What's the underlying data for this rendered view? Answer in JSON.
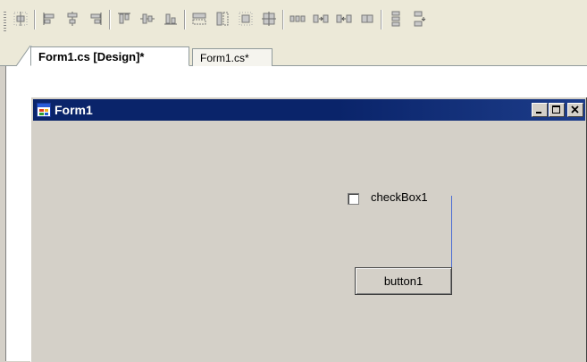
{
  "toolbar": {
    "buttons": [
      {
        "icon": "align-to-grid-icon"
      },
      {
        "icon": "align-lefts-icon"
      },
      {
        "icon": "align-centers-icon"
      },
      {
        "icon": "align-rights-icon"
      },
      {
        "icon": "align-tops-icon"
      },
      {
        "icon": "align-middles-icon"
      },
      {
        "icon": "align-bottoms-icon"
      },
      {
        "icon": "make-same-width-icon"
      },
      {
        "icon": "make-same-height-icon"
      },
      {
        "icon": "size-to-grid-icon"
      },
      {
        "icon": "make-same-size-icon"
      },
      {
        "icon": "horizontal-spacing-equal-icon"
      },
      {
        "icon": "horizontal-spacing-increase-icon"
      },
      {
        "icon": "horizontal-spacing-decrease-icon"
      },
      {
        "icon": "horizontal-spacing-remove-icon"
      },
      {
        "icon": "vertical-spacing-equal-icon"
      },
      {
        "icon": "vertical-spacing-increase-icon"
      }
    ]
  },
  "tabs": [
    {
      "label": "Form1.cs [Design]*",
      "active": true
    },
    {
      "label": "Form1.cs*",
      "active": false
    }
  ],
  "form": {
    "title": "Form1",
    "caption_buttons": [
      "minimize",
      "maximize",
      "close"
    ],
    "checkbox": {
      "label": "checkBox1",
      "checked": false
    },
    "button": {
      "label": "button1"
    }
  },
  "colors": {
    "titlebar": "#0a246a",
    "form_back": "#d4d0c8",
    "selection_line": "#4a6cd4"
  }
}
